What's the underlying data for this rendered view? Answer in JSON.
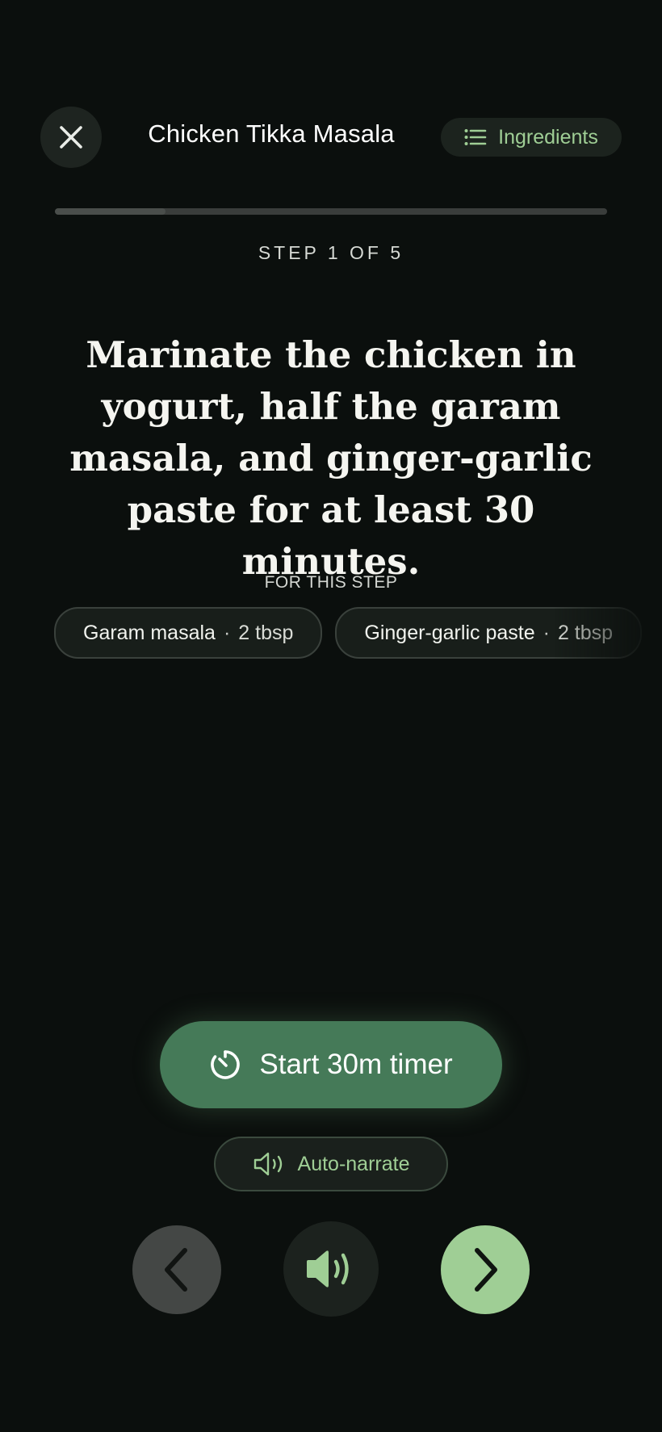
{
  "header": {
    "title": "Chicken Tikka Masala",
    "ingredients_label": "Ingredients",
    "close_icon": "close-icon",
    "list_icon": "list-icon"
  },
  "progress": {
    "current_step": 1,
    "total_steps": 5,
    "fraction": 0.2,
    "label": "STEP 1 OF 5"
  },
  "step": {
    "instruction": "Marinate the chicken in yogurt, half the garam masala, and ginger-garlic paste for at least 30 minutes.",
    "for_this_step_label": "FOR THIS STEP",
    "ingredients": [
      {
        "name": "Garam masala",
        "separator": "·",
        "quantity": "2 tbsp"
      },
      {
        "name": "Ginger-garlic paste",
        "separator": "·",
        "quantity": "2 tbsp"
      }
    ]
  },
  "actions": {
    "timer_label": "Start 30m timer",
    "timer_icon": "timer-icon",
    "narrate_label": "Auto-narrate",
    "narrate_icon": "speaker-outline-icon"
  },
  "nav": {
    "prev_icon": "chevron-left-icon",
    "speak_icon": "speaker-icon",
    "next_icon": "chevron-right-icon"
  },
  "colors": {
    "background": "#0b0f0d",
    "accent": "#9fce95",
    "timer_button": "#457a58"
  }
}
